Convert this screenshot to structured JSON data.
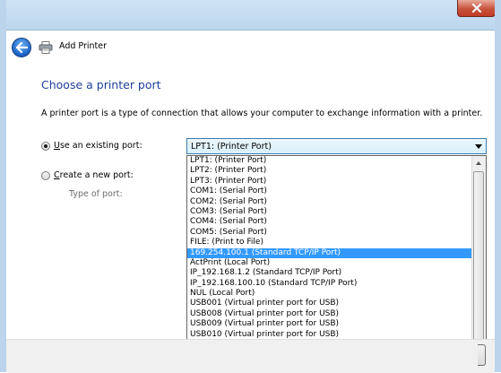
{
  "window": {
    "title": "Add Printer",
    "close_icon": "close-icon"
  },
  "page": {
    "heading": "Choose a printer port",
    "description": "A printer port is a type of connection that allows your computer to exchange information with a printer."
  },
  "options": {
    "use_existing": {
      "accel": "U",
      "rest": "se an existing port:",
      "checked": true
    },
    "create_new": {
      "accel": "C",
      "rest": "reate a new port:",
      "checked": false
    },
    "type_of_port_label": "Type of port:"
  },
  "port_combo": {
    "value": "LPT1: (Printer Port)"
  },
  "port_list": [
    "LPT1: (Printer Port)",
    "LPT2: (Printer Port)",
    "LPT3: (Printer Port)",
    "COM1: (Serial Port)",
    "COM2: (Serial Port)",
    "COM3: (Serial Port)",
    "COM4: (Serial Port)",
    "COM5: (Serial Port)",
    "FILE: (Print to File)",
    "169.254.100.1 (Standard TCP/IP Port)",
    "ActPrint (Local Port)",
    "IP_192.168.1.2 (Standard TCP/IP Port)",
    "IP_192.168.100.10 (Standard TCP/IP Port)",
    "NUL (Local Port)",
    "USB001 (Virtual printer port for USB)",
    "USB008 (Virtual printer port for USB)",
    "USB009 (Virtual printer port for USB)",
    "USB010 (Virtual printer port for USB)"
  ],
  "selected_port_index": 9,
  "colors": {
    "heading": "#1e3e9b",
    "selection": "#3399ff",
    "frame": "#bcd4ec"
  }
}
